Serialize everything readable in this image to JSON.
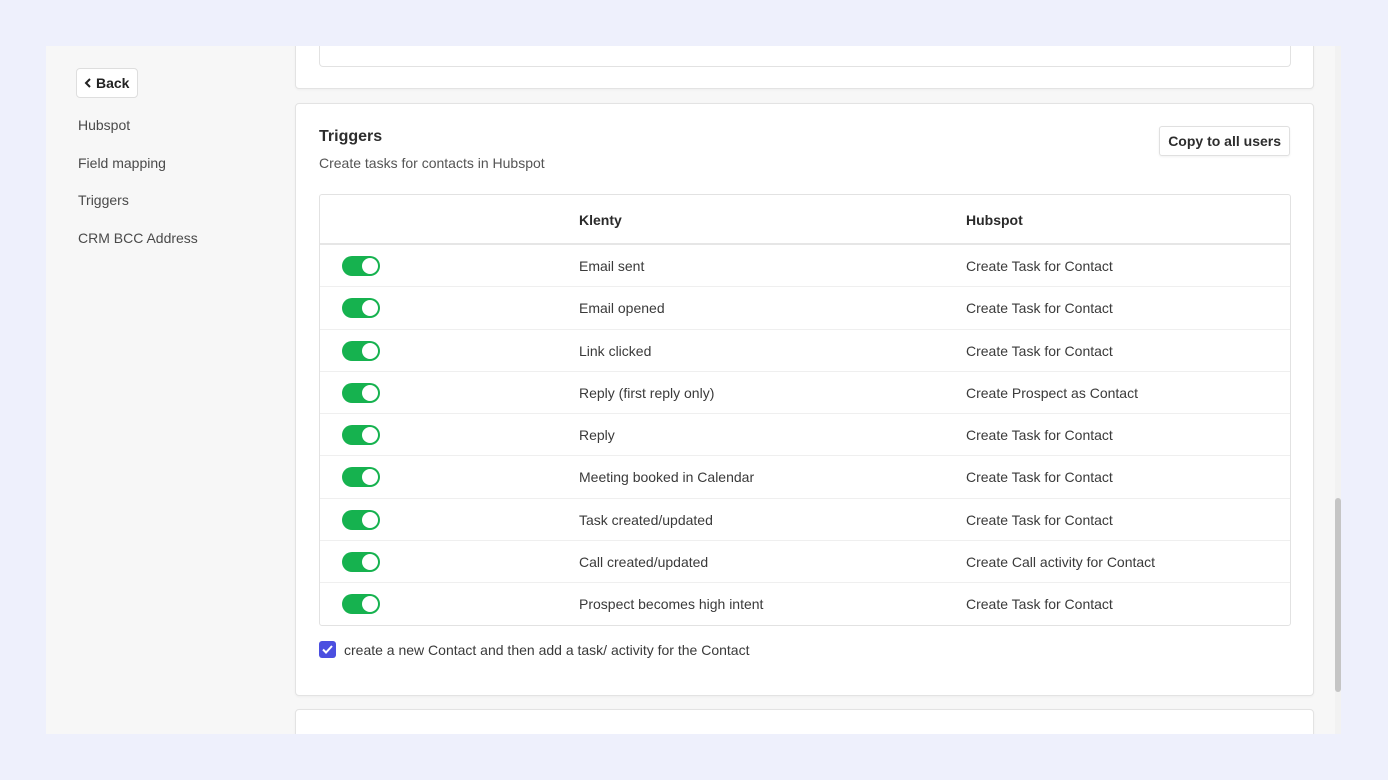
{
  "sidebar": {
    "back_label": "Back",
    "items": [
      {
        "label": "Hubspot"
      },
      {
        "label": "Field mapping"
      },
      {
        "label": "Triggers"
      },
      {
        "label": "CRM BCC Address"
      }
    ]
  },
  "triggers": {
    "title": "Triggers",
    "subtitle": "Create tasks for contacts in Hubspot",
    "copy_button": "Copy to all users",
    "columns": {
      "klenty": "Klenty",
      "hubspot": "Hubspot"
    },
    "rows": [
      {
        "enabled": true,
        "klenty": "Email sent",
        "hubspot": "Create Task for Contact"
      },
      {
        "enabled": true,
        "klenty": "Email opened",
        "hubspot": "Create Task for Contact"
      },
      {
        "enabled": true,
        "klenty": "Link clicked",
        "hubspot": "Create Task for Contact"
      },
      {
        "enabled": true,
        "klenty": "Reply (first reply only)",
        "hubspot": "Create Prospect as Contact"
      },
      {
        "enabled": true,
        "klenty": "Reply",
        "hubspot": "Create Task for Contact"
      },
      {
        "enabled": true,
        "klenty": "Meeting booked in Calendar",
        "hubspot": "Create Task for Contact"
      },
      {
        "enabled": true,
        "klenty": "Task created/updated",
        "hubspot": "Create Task for Contact"
      },
      {
        "enabled": true,
        "klenty": "Call created/updated",
        "hubspot": "Create Call activity for Contact"
      },
      {
        "enabled": true,
        "klenty": "Prospect becomes high intent",
        "hubspot": "Create Task for Contact"
      }
    ],
    "checkbox": {
      "checked": true,
      "label": "create a new Contact and then add a task/ activity for the Contact"
    }
  },
  "colors": {
    "toggle_on": "#16b24f",
    "checkbox": "#4b4fe0",
    "page_background": "#eef0fc"
  }
}
